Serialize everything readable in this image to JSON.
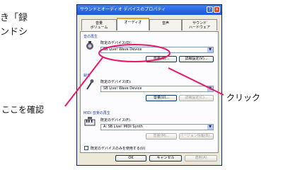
{
  "background": {
    "line1": "き「録",
    "line2": "ンドシ"
  },
  "callouts": {
    "left": "ここを確認",
    "right": "クリック"
  },
  "dialog": {
    "title": "サウンドとオーディオ デバイスのプロパティ",
    "tabs": [
      "ボリューム",
      "音量",
      "サウンド",
      "オーディオ",
      "音声",
      "ハードウェア"
    ],
    "active_tab": "オーディオ",
    "groups": [
      {
        "label": "音の再生",
        "device_label": "既定のデバイス(D):",
        "device_value": "SB Live! Wave Device",
        "buttons": [
          "音量(O)...",
          "詳細設定(V)..."
        ]
      },
      {
        "label": "録音",
        "device_label": "既定のデバイス(E):",
        "device_value": "SB Live! Wave Device",
        "buttons": [
          "音量(U)...",
          "詳細設定(C)..."
        ]
      },
      {
        "label": "MIDI 音楽の再生",
        "device_label": "既定のデバイス(F):",
        "device_value": "A: SB Live! MIDI Synth",
        "buttons": [
          "音量(M)...",
          "バージョン情報(B)..."
        ]
      }
    ],
    "checkbox_label": "既定のデバイスのみを使用する(U)",
    "bottom_buttons": [
      "OK",
      "キャンセル",
      "適用(A)"
    ]
  },
  "colors": {
    "callout_line": "#e8186a",
    "highlight": "#e8186a"
  }
}
